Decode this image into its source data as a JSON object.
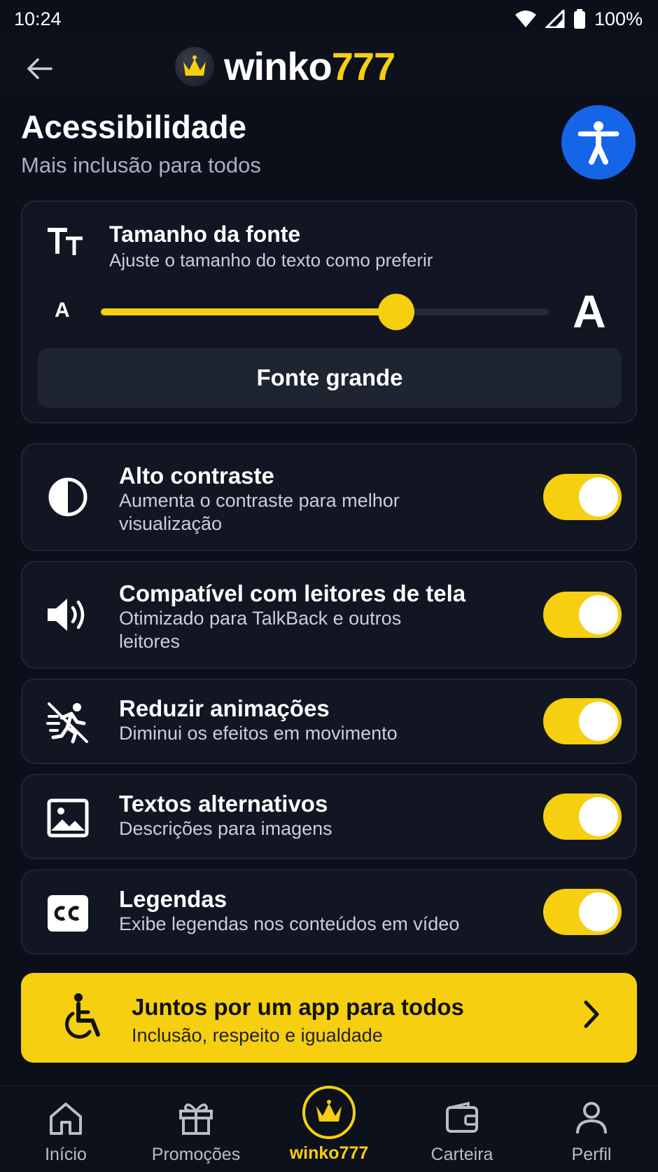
{
  "status_bar": {
    "time": "10:24",
    "battery": "100%"
  },
  "app_bar": {
    "brand_part1": "winko",
    "brand_part2": "777"
  },
  "header": {
    "title": "Acessibilidade",
    "subtitle": "Mais inclusão para todos"
  },
  "font_size": {
    "title": "Tamanho da fonte",
    "description": "Ajuste o tamanho do texto como preferir",
    "small_label": "A",
    "large_label": "A",
    "slider_value": 0.66,
    "preset_button": "Fonte grande"
  },
  "settings": [
    {
      "id": "high-contrast",
      "icon": "contrast-icon",
      "title": "Alto contraste",
      "desc_line1": "Aumenta o contraste para melhor",
      "desc_line2": "visualização",
      "enabled": true
    },
    {
      "id": "screen-reader",
      "icon": "speaker-icon",
      "title": "Compatível com leitores de tela",
      "desc_line1": "Otimizado para TalkBack e outros",
      "desc_line2": "leitores",
      "enabled": true
    },
    {
      "id": "reduce-motion",
      "icon": "reduce-motion-icon",
      "title": "Reduzir animações",
      "desc_line1": "Diminui os efeitos em movimento",
      "enabled": true
    },
    {
      "id": "alt-text",
      "icon": "image-icon",
      "title": "Textos alternativos",
      "desc_line1": "Descrições para imagens",
      "enabled": true
    },
    {
      "id": "captions",
      "icon": "closed-captions-icon",
      "title": "Legendas",
      "desc_line1": "Exibe legendas nos conteúdos em vídeo",
      "enabled": true
    }
  ],
  "banner": {
    "title": "Juntos por um app para todos",
    "subtitle": "Inclusão, respeito e igualdade"
  },
  "bottom_nav": [
    {
      "label": "Início",
      "icon": "home-icon"
    },
    {
      "label": "Promoções",
      "icon": "gift-icon"
    },
    {
      "label": "winko777",
      "icon": "crown-icon",
      "active": true
    },
    {
      "label": "Carteira",
      "icon": "wallet-icon"
    },
    {
      "label": "Perfil",
      "icon": "person-icon"
    }
  ],
  "colors": {
    "accent": "#f5cf10",
    "background": "#0b0f1a",
    "card": "#121622",
    "fab": "#1565e8"
  }
}
